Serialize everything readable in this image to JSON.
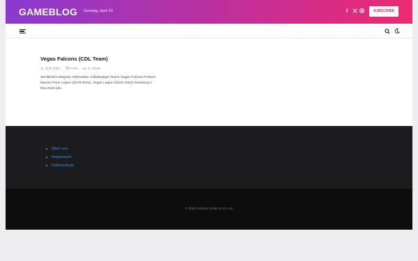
{
  "header": {
    "logo": "GAMEBLOG",
    "date": "Sonntag, April 20",
    "social_icons": [
      "facebook-icon",
      "x-icon",
      "instagram-icon"
    ],
    "subscribe_label": "SUBSCRIBE"
  },
  "nav": {
    "icons": [
      "menu-icon",
      "search-icon",
      "dark-mode-moon-icon"
    ]
  },
  "article": {
    "title": "Vegas Falcons (CDL Team)",
    "date": "11. April 2025",
    "read_time": "4 min",
    "views": "21 Views",
    "excerpt": "Steckbrief Kategorie Information Vollständiger Name Vegas Falcons Frühere Namen Paris Legion (2019-2022), Vegas Legion (2022-2024) Gründung 2. Mai 2019 (als..."
  },
  "footer": {
    "links": [
      "Über uns",
      "Impressum",
      "Datenschutz"
    ],
    "copyright": "© 2025 Softclick GmbH & Co. KG"
  },
  "colors": {
    "gradient_start": "#8a3ad0",
    "gradient_end": "#ee2a72",
    "footer_dark": "#1c1c1e",
    "footer_darker": "#0d0d0d",
    "link": "#3d8fe0"
  }
}
